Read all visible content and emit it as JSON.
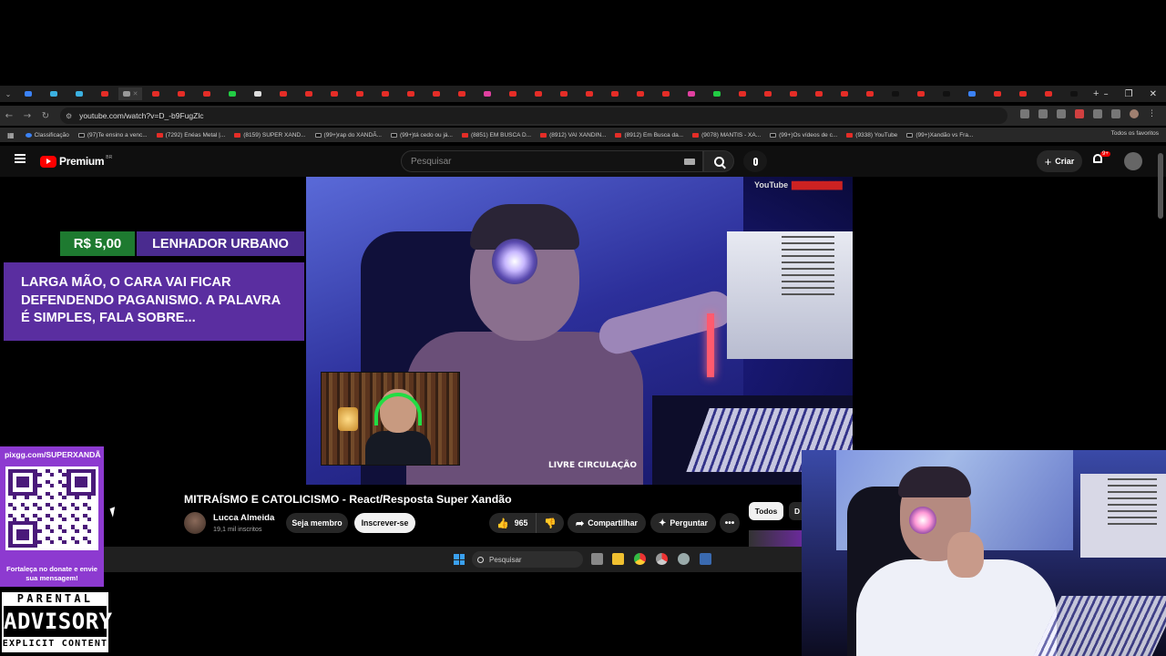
{
  "browser": {
    "tab_favicons": [
      "#3b82f6",
      "#3bb0e0",
      "#3bb0e0",
      "#e52d27",
      "#999999",
      "#e52d27",
      "#e52d27",
      "#e52d27",
      "#22cc44",
      "#dddddd",
      "#e52d27",
      "#e52d27",
      "#e52d27",
      "#e52d27",
      "#e52d27",
      "#e52d27",
      "#e52d27",
      "#e52d27",
      "#e040a0",
      "#e52d27",
      "#e52d27",
      "#e52d27",
      "#e52d27",
      "#e52d27",
      "#e52d27",
      "#e52d27",
      "#e040a0",
      "#22cc44",
      "#e52d27",
      "#e52d27",
      "#e52d27",
      "#e52d27",
      "#e52d27",
      "#e52d27",
      "#111111",
      "#e52d27",
      "#111111",
      "#3b82f6",
      "#e52d27",
      "#e52d27",
      "#e52d27",
      "#111111"
    ],
    "new_tab_label": "+",
    "window_controls": {
      "minimize": "–",
      "maximize": "❐",
      "close": "✕"
    },
    "url": "youtube.com/watch?v=D_-b9FugZlc",
    "bookmarks": [
      {
        "icon": "classroom-icon",
        "label": "Classificação"
      },
      {
        "icon": "tiktok-icon",
        "label": "(97)Te ensino a venc..."
      },
      {
        "icon": "youtube-icon",
        "label": "(7292) Enéas Metal |..."
      },
      {
        "icon": "youtube-icon",
        "label": "(8159) SUPER XAND..."
      },
      {
        "icon": "tiktok-icon",
        "label": "(99+)rap do XANDÃ..."
      },
      {
        "icon": "tiktok-icon",
        "label": "(99+)tá cedo ou já..."
      },
      {
        "icon": "youtube-icon",
        "label": "(8851) EM BUSCA D..."
      },
      {
        "icon": "youtube-icon",
        "label": "(8912) VAI XANDIN..."
      },
      {
        "icon": "youtube-icon",
        "label": "(8912) Em Busca da..."
      },
      {
        "icon": "youtube-icon",
        "label": "(9078) MANTIS - XA..."
      },
      {
        "icon": "tiktok-icon",
        "label": "(99+)Os vídeos de c..."
      },
      {
        "icon": "youtube-icon",
        "label": "(9338) YouTube"
      },
      {
        "icon": "tiktok-icon",
        "label": "(99+)Xandão vs Fra..."
      }
    ],
    "all_bookmarks": "Todos os favoritos"
  },
  "youtube": {
    "brand": "Premium",
    "region": "BR",
    "search_placeholder": "Pesquisar",
    "create_label": "Criar",
    "notification_badge": "9+",
    "watermark_brand": "YouTube",
    "video_overlay_text": "LIVRE CIRCULAÇÃO",
    "video_title": "MITRAÍSMO E CATOLICISMO - React/Resposta Super Xandão",
    "channel_name": "Lucca Almeida",
    "channel_subs": "19,1 mil inscritos",
    "member_label": "Seja membro",
    "subscribe_label": "Inscrever-se",
    "likes": "965",
    "share_label": "Compartilhar",
    "ask_label": "Perguntar",
    "more_label": "•••",
    "chip_all": "Todos",
    "chip_next": "D"
  },
  "donation": {
    "amount": "R$ 5,00",
    "donor": "LENHADOR URBANO",
    "message": "LARGA MÃO, O CARA VAI FICAR DEFENDENDO PAGANISMO. A PALAVRA É SIMPLES, FALA SOBRE..."
  },
  "qr_panel": {
    "url": "pixgg.com/SUPERXANDÃ",
    "caption": "Fortaleça no donate e envie sua mensagem!"
  },
  "advisory": {
    "top": "PARENTAL",
    "middle": "ADVISORY",
    "bottom": "EXPLICIT CONTENT"
  },
  "taskbar": {
    "search_placeholder": "Pesquisar",
    "apps": [
      "task-view-icon",
      "file-explorer-icon",
      "chrome-icon",
      "chrome-alt-icon",
      "settings-icon",
      "steam-icon"
    ]
  },
  "colors": {
    "donation_green": "#1e7a30",
    "donation_purple": "#4a2b8f",
    "message_purple": "#5a2ea0",
    "qr_purple": "#8d3ad0",
    "youtube_red": "#ff0000"
  }
}
